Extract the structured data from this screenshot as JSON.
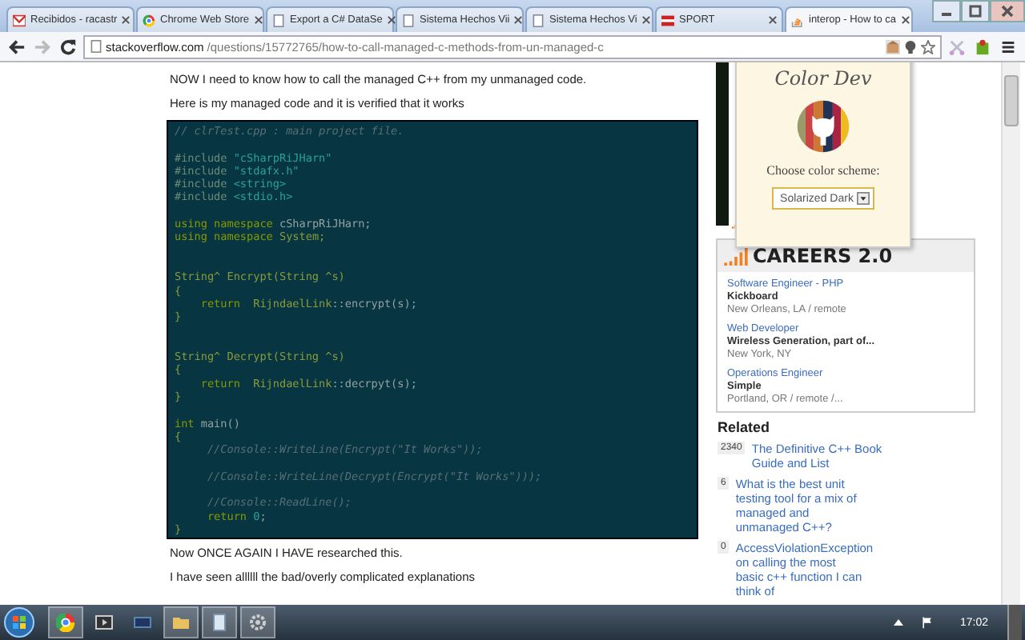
{
  "tabs": [
    {
      "title": "Recibidos - racastr",
      "selected": false
    },
    {
      "title": "Chrome Web Store",
      "selected": false
    },
    {
      "title": "Export a C# DataSe",
      "selected": false
    },
    {
      "title": "Sistema Hechos Vii",
      "selected": false
    },
    {
      "title": "Sistema Hechos Vi",
      "selected": false
    },
    {
      "title": "SPORT",
      "selected": false
    },
    {
      "title": "interop - How to ca",
      "selected": true
    }
  ],
  "address_bar": {
    "domain": "stackoverflow.com",
    "path": "/questions/15772765/how-to-call-managed-c-methods-from-un-managed-c"
  },
  "question": {
    "intro": [
      "NOW I need to know how to call the managed C++ from my unmanaged code.",
      "Here is my managed code and it is verified that it works"
    ],
    "code": [
      {
        "kind": "code",
        "segments": [
          {
            "kind": "comment",
            "text": "// clrTest.cpp : main project file."
          }
        ]
      },
      {
        "kind": "blank"
      },
      {
        "kind": "code",
        "segments": [
          {
            "kind": "directive",
            "text": "#include "
          },
          {
            "kind": "string",
            "text": "\"cSharpRiJHarn\""
          }
        ]
      },
      {
        "kind": "code",
        "segments": [
          {
            "kind": "directive",
            "text": "#include "
          },
          {
            "kind": "string",
            "text": "\"stdafx.h\""
          }
        ]
      },
      {
        "kind": "code",
        "segments": [
          {
            "kind": "directive",
            "text": "#include "
          },
          {
            "kind": "string",
            "text": "<string>"
          }
        ]
      },
      {
        "kind": "code",
        "segments": [
          {
            "kind": "directive",
            "text": "#include "
          },
          {
            "kind": "string",
            "text": "<stdio.h>"
          }
        ]
      },
      {
        "kind": "blank"
      },
      {
        "kind": "code",
        "segments": [
          {
            "kind": "keyword",
            "text": "using namespace "
          },
          {
            "kind": "plain",
            "text": "cSharpRiJHarn;"
          }
        ]
      },
      {
        "kind": "code",
        "segments": [
          {
            "kind": "keyword",
            "text": "using namespace "
          },
          {
            "kind": "type",
            "text": "System;"
          }
        ]
      },
      {
        "kind": "blank"
      },
      {
        "kind": "blank"
      },
      {
        "kind": "code",
        "segments": [
          {
            "kind": "type",
            "text": "String^ Encrypt(String ^s)"
          }
        ]
      },
      {
        "kind": "code",
        "segments": [
          {
            "kind": "type",
            "text": "{"
          }
        ]
      },
      {
        "kind": "code",
        "segments": [
          {
            "kind": "keyword",
            "text": "    return  "
          },
          {
            "kind": "type",
            "text": "RijndaelLink"
          },
          {
            "kind": "plain",
            "text": "::encrypt(s);"
          }
        ]
      },
      {
        "kind": "code",
        "segments": [
          {
            "kind": "type",
            "text": "}"
          }
        ]
      },
      {
        "kind": "blank"
      },
      {
        "kind": "blank"
      },
      {
        "kind": "code",
        "segments": [
          {
            "kind": "type",
            "text": "String^ Decrypt(String ^s)"
          }
        ]
      },
      {
        "kind": "code",
        "segments": [
          {
            "kind": "type",
            "text": "{"
          }
        ]
      },
      {
        "kind": "code",
        "segments": [
          {
            "kind": "keyword",
            "text": "    return  "
          },
          {
            "kind": "type",
            "text": "RijndaelLink"
          },
          {
            "kind": "plain",
            "text": "::decrpyt(s);"
          }
        ]
      },
      {
        "kind": "code",
        "segments": [
          {
            "kind": "type",
            "text": "}"
          }
        ]
      },
      {
        "kind": "blank"
      },
      {
        "kind": "code",
        "segments": [
          {
            "kind": "keyword",
            "text": "int "
          },
          {
            "kind": "plain",
            "text": "main()"
          }
        ]
      },
      {
        "kind": "code",
        "segments": [
          {
            "kind": "type",
            "text": "{"
          }
        ]
      },
      {
        "kind": "code",
        "segments": [
          {
            "kind": "comment",
            "text": "     //Console::WriteLine(Encrypt(\"It Works\"));"
          }
        ]
      },
      {
        "kind": "blank"
      },
      {
        "kind": "code",
        "segments": [
          {
            "kind": "comment",
            "text": "     //Console::WriteLine(Decrypt(Encrypt(\"It Works\")));"
          }
        ]
      },
      {
        "kind": "blank"
      },
      {
        "kind": "code",
        "segments": [
          {
            "kind": "comment",
            "text": "     //Console::ReadLine();"
          }
        ]
      },
      {
        "kind": "code",
        "segments": [
          {
            "kind": "keyword",
            "text": "     return "
          },
          {
            "kind": "string",
            "text": "0"
          },
          {
            "kind": "plain",
            "text": ";"
          }
        ]
      },
      {
        "kind": "code",
        "segments": [
          {
            "kind": "type",
            "text": "}"
          }
        ]
      }
    ],
    "after": [
      "Now ONCE AGAIN I HAVE researched this.",
      "I have seen allllll the bad/overly complicated explanations"
    ]
  },
  "popup": {
    "title": "Color Dev",
    "label": "Choose color scheme:",
    "scheme": "Solarized Dark"
  },
  "careers": {
    "title": "CAREERS 2.0",
    "jobs": [
      {
        "title": "Software Engineer - PHP",
        "company": "Kickboard",
        "location": "New Orleans, LA / remote"
      },
      {
        "title": "Web Developer",
        "company": "Wireless Generation, part of...",
        "location": "New York, NY"
      },
      {
        "title": "Operations Engineer",
        "company": "Simple",
        "location": "Portland, OR / remote /..."
      }
    ]
  },
  "related": {
    "title": "Related",
    "items": [
      {
        "count": "2340",
        "title": "The Definitive C++ Book Guide and List"
      },
      {
        "count": "6",
        "title": "What is the best unit testing tool for a mix of managed and unmanaged C++?"
      },
      {
        "count": "0",
        "title": "AccessViolationException on calling the most basic c++ function I can think of"
      }
    ]
  },
  "taskbar": {
    "clock": "17:02"
  }
}
